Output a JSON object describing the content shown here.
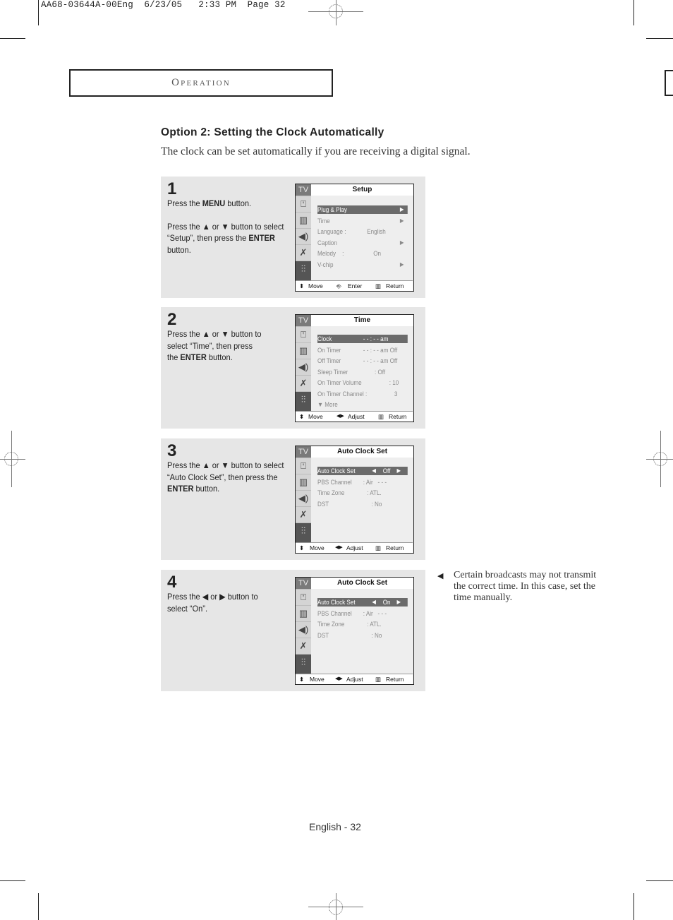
{
  "slug": {
    "text": "AA68-03644A-00Eng  6/23/05   2:33 PM  Page 32"
  },
  "section": {
    "title": "Operation"
  },
  "heading": "Option 2: Setting the Clock Automatically",
  "intro": "The clock can be set automatically if you are receiving a digital signal.",
  "steps": [
    {
      "number": "1",
      "text_parts": {
        "a1": "Press the ",
        "b1": "MENU",
        "a2": " button.",
        "a3": "Press the ▲ or ▼ button to select “Setup”, then press the ",
        "b2": "ENTER",
        "a4": " button."
      },
      "osd": {
        "tv_label": "TV",
        "title": "Setup",
        "rows": [
          {
            "label": "Plug & Play",
            "value": "",
            "arrow": "▶",
            "selected": true
          },
          {
            "label": "Time",
            "value": "",
            "arrow": "▶",
            "selected": false
          },
          {
            "label": "Language :",
            "value": "English",
            "arrow": "",
            "selected": false
          },
          {
            "label": "Caption",
            "value": "",
            "arrow": "▶",
            "selected": false
          },
          {
            "label": "Melody    :",
            "value": "On",
            "arrow": "",
            "selected": false
          },
          {
            "label": "V-chip",
            "value": "",
            "arrow": "▶",
            "selected": false
          }
        ],
        "footer": {
          "move": "Move",
          "mid": "Enter",
          "ret": "Return"
        }
      }
    },
    {
      "number": "2",
      "text_parts": {
        "a1": "Press the ▲ or ▼ button to select “Time”, then press the ",
        "b1": "ENTER",
        "a2": " button."
      },
      "osd": {
        "tv_label": "TV",
        "title": "Time",
        "rows": [
          {
            "label": "Clock",
            "value": "- - : - - am",
            "selected": true
          },
          {
            "label": "On Timer",
            "value": "- - : - - am Off",
            "selected": false
          },
          {
            "label": "Off Timer",
            "value": "- - : - - am Off",
            "selected": false
          },
          {
            "label": "Sleep Timer",
            "value": ": Off",
            "selected": false
          },
          {
            "label": "On Timer Volume",
            "value": ": 10",
            "selected": false
          },
          {
            "label": "On Timer Channel :",
            "value": "3",
            "selected": false
          },
          {
            "label": "▼ More",
            "value": "",
            "selected": false
          }
        ],
        "footer": {
          "move": "Move",
          "mid": "Adjust",
          "ret": "Return"
        }
      }
    },
    {
      "number": "3",
      "text_parts": {
        "a1": "Press the ▲ or ▼ button to select “Auto Clock Set”, then press the ",
        "b1": "ENTER",
        "a2": " button."
      },
      "osd": {
        "tv_label": "TV",
        "title": "Auto Clock Set",
        "rows": [
          {
            "label": "Auto Clock Set",
            "value": "Off",
            "selected": true
          },
          {
            "label": "PBS Channel",
            "value": ": Air   - - -",
            "selected": false
          },
          {
            "label": "Time Zone",
            "value": ": ATL.",
            "selected": false
          },
          {
            "label": "DST",
            "value": ": No",
            "selected": false
          }
        ],
        "footer": {
          "move": "Move",
          "mid": "Adjust",
          "ret": "Return"
        }
      }
    },
    {
      "number": "4",
      "text_parts": {
        "a1": "Press the ◀ or ▶ button to select “On”."
      },
      "osd": {
        "tv_label": "TV",
        "title": "Auto Clock Set",
        "rows": [
          {
            "label": "Auto Clock Set",
            "value": "On",
            "selected": true
          },
          {
            "label": "PBS Channel",
            "value": ": Air   - - -",
            "selected": false
          },
          {
            "label": "Time Zone",
            "value": ": ATL.",
            "selected": false
          },
          {
            "label": "DST",
            "value": ": No",
            "selected": false
          }
        ],
        "footer": {
          "move": "Move",
          "mid": "Adjust",
          "ret": "Return"
        }
      }
    }
  ],
  "note": {
    "bullet": "◀",
    "text": "Certain broadcasts may not transmit the correct time. In this case, set the time manually."
  },
  "footer": {
    "page_label": "English - 32"
  },
  "icons": {
    "left_arrow": "◀",
    "right_arrow": "▶",
    "updown": "⬍",
    "leftright": "◀▶",
    "enter": "⏎",
    "return": "Ⅲ",
    "input": "⚲",
    "picture": "▥",
    "sound": "🔈",
    "channel": "⩚",
    "setup": "⫶"
  }
}
